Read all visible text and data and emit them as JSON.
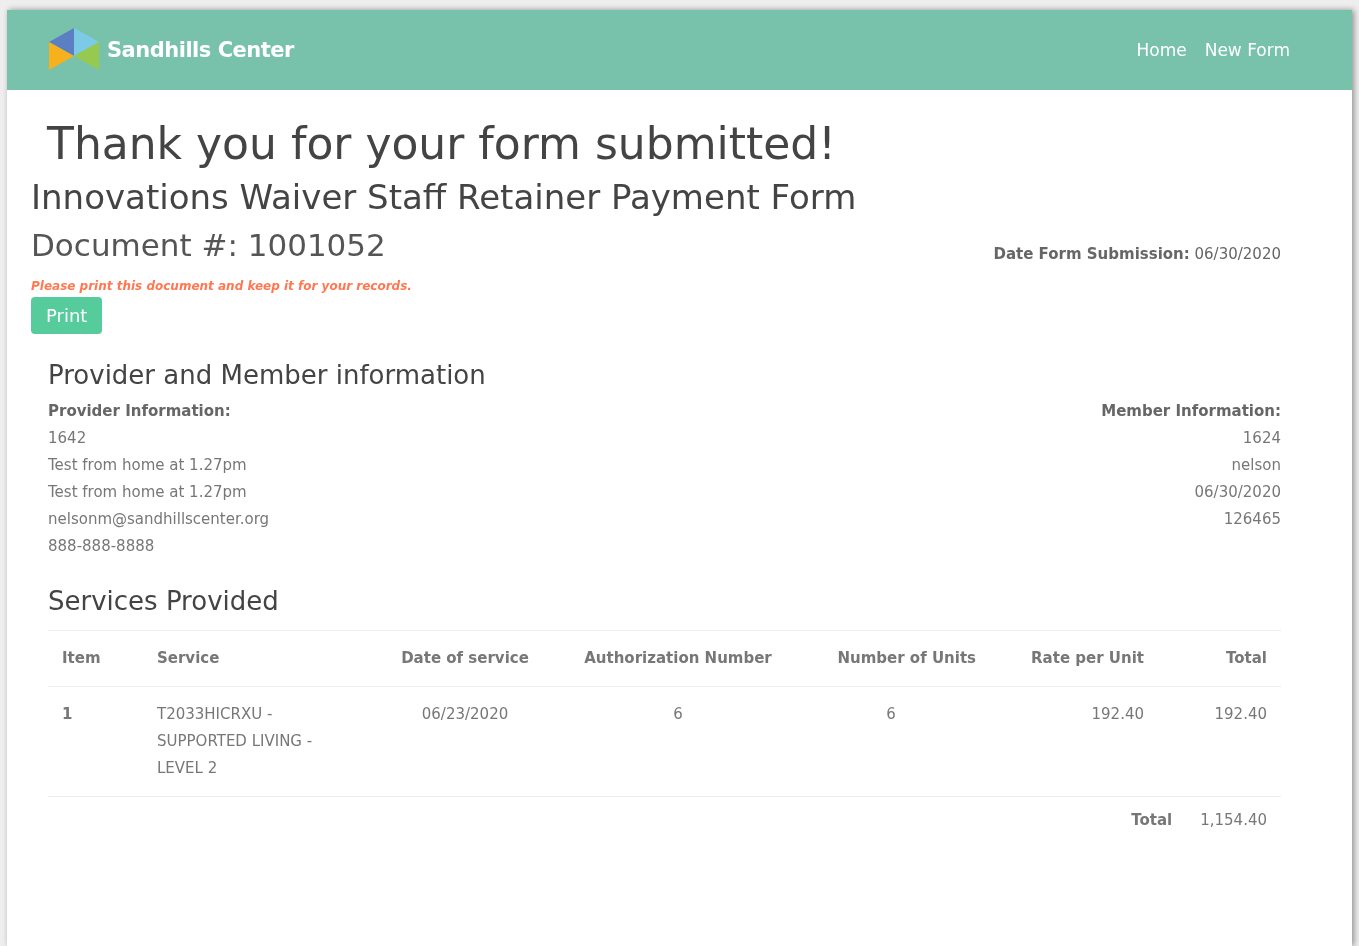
{
  "navbar": {
    "brand": "Sandhills Center",
    "links": [
      "Home",
      "New Form"
    ]
  },
  "heading": "Thank you for your form submitted!",
  "form_title": "Innovations Waiver Staff Retainer Payment Form",
  "document_number": "Document #: 1001052",
  "submission": {
    "label": "Date Form Submission:",
    "value": "06/30/2020"
  },
  "notice": "Please print this document and keep it for your records.",
  "print_button": "Print",
  "info_section": {
    "title": "Provider and Member information",
    "provider": {
      "label": "Provider Information:",
      "lines": [
        "1642",
        "Test from home at 1.27pm",
        "Test from home at 1.27pm",
        "nelsonm@sandhillscenter.org",
        "888-888-8888"
      ]
    },
    "member": {
      "label": "Member Information:",
      "lines": [
        "1624",
        "nelson",
        "06/30/2020",
        "126465"
      ]
    }
  },
  "services": {
    "title": "Services Provided",
    "columns": [
      "Item",
      "Service",
      "Date of service",
      "Authorization Number",
      "Number of Units",
      "Rate per Unit",
      "Total"
    ],
    "rows": [
      [
        "1",
        "T2033HICRXU - SUPPORTED LIVING - LEVEL 2",
        "06/23/2020",
        "6",
        "6",
        "192.40",
        "192.40"
      ]
    ],
    "footer": {
      "label": "Total",
      "value": "1,154.40"
    }
  }
}
